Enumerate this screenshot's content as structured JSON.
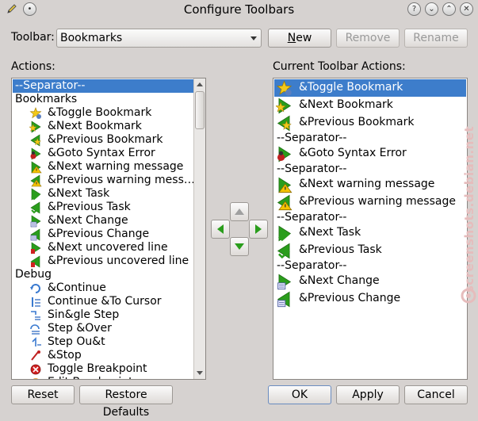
{
  "window": {
    "title": "Configure Toolbars",
    "controls": [
      "?",
      "⌄",
      "⌃",
      "✕"
    ]
  },
  "toolbar_selector": {
    "label": "Toolbar:",
    "value": "Bookmarks",
    "new_label": "New",
    "remove_label": "Remove",
    "rename_label": "Rename"
  },
  "actions": {
    "label": "Actions:",
    "items": [
      {
        "text": "--Separator--",
        "type": "separator",
        "selected": true
      },
      {
        "text": "Bookmarks",
        "type": "group"
      },
      {
        "text": "&Toggle Bookmark",
        "type": "item",
        "icon": "bookmark-toggle-icon"
      },
      {
        "text": "&Next Bookmark",
        "type": "item",
        "icon": "bookmark-next-icon"
      },
      {
        "text": "&Previous Bookmark",
        "type": "item",
        "icon": "bookmark-previous-icon"
      },
      {
        "text": "&Goto Syntax Error",
        "type": "item",
        "icon": "goto-error-icon"
      },
      {
        "text": "&Next warning message",
        "type": "item",
        "icon": "next-warning-icon"
      },
      {
        "text": "&Previous warning mess…",
        "type": "item",
        "icon": "previous-warning-icon"
      },
      {
        "text": "&Next Task",
        "type": "item",
        "icon": "next-task-icon"
      },
      {
        "text": "&Previous Task",
        "type": "item",
        "icon": "previous-task-icon"
      },
      {
        "text": "&Next Change",
        "type": "item",
        "icon": "next-change-icon"
      },
      {
        "text": "&Previous Change",
        "type": "item",
        "icon": "previous-change-icon"
      },
      {
        "text": "&Next uncovered line",
        "type": "item",
        "icon": "next-uncovered-icon"
      },
      {
        "text": "&Previous uncovered line",
        "type": "item",
        "icon": "previous-uncovered-icon"
      },
      {
        "text": "Debug",
        "type": "group"
      },
      {
        "text": "&Continue",
        "type": "item",
        "icon": "continue-icon"
      },
      {
        "text": "Continue &To Cursor",
        "type": "item",
        "icon": "continue-to-cursor-icon"
      },
      {
        "text": "Sin&gle Step",
        "type": "item",
        "icon": "single-step-icon"
      },
      {
        "text": "Step &Over",
        "type": "item",
        "icon": "step-over-icon"
      },
      {
        "text": "Step Ou&t",
        "type": "item",
        "icon": "step-out-icon"
      },
      {
        "text": "&Stop",
        "type": "item",
        "icon": "stop-icon"
      },
      {
        "text": "Toggle Breakpoint",
        "type": "item",
        "icon": "toggle-breakpoint-icon"
      },
      {
        "text": "Edit Breakpoint",
        "type": "item",
        "icon": "edit-breakpoint-icon"
      }
    ]
  },
  "current": {
    "label": "Current Toolbar Actions:",
    "items": [
      {
        "text": "&Toggle Bookmark",
        "type": "item",
        "icon": "bookmark-toggle-icon",
        "selected": true
      },
      {
        "text": "&Next Bookmark",
        "type": "item",
        "icon": "bookmark-next-icon"
      },
      {
        "text": "&Previous Bookmark",
        "type": "item",
        "icon": "bookmark-previous-icon"
      },
      {
        "text": "--Separator--",
        "type": "separator"
      },
      {
        "text": "&Goto Syntax Error",
        "type": "item",
        "icon": "goto-error-icon"
      },
      {
        "text": "--Separator--",
        "type": "separator"
      },
      {
        "text": "&Next warning message",
        "type": "item",
        "icon": "next-warning-icon"
      },
      {
        "text": "&Previous warning message",
        "type": "item",
        "icon": "previous-warning-icon"
      },
      {
        "text": "--Separator--",
        "type": "separator"
      },
      {
        "text": "&Next Task",
        "type": "item",
        "icon": "next-task-icon"
      },
      {
        "text": "&Previous Task",
        "type": "item",
        "icon": "previous-task-icon"
      },
      {
        "text": "--Separator--",
        "type": "separator"
      },
      {
        "text": "&Next Change",
        "type": "item",
        "icon": "next-change-icon"
      },
      {
        "text": "&Previous Change",
        "type": "item",
        "icon": "previous-change-icon"
      }
    ]
  },
  "footer": {
    "reset_label": "Reset",
    "restore_label": "Restore Defaults",
    "ok_label": "OK",
    "apply_label": "Apply",
    "cancel_label": "Cancel"
  },
  "watermark": "screenshots.debian.net",
  "colors": {
    "selection": "#3d7dcb",
    "window_bg": "#d6d2d0",
    "arrow_green": "#2a9d1c",
    "star_yellow": "#f2c81a",
    "warning_yellow": "#f5c400"
  }
}
